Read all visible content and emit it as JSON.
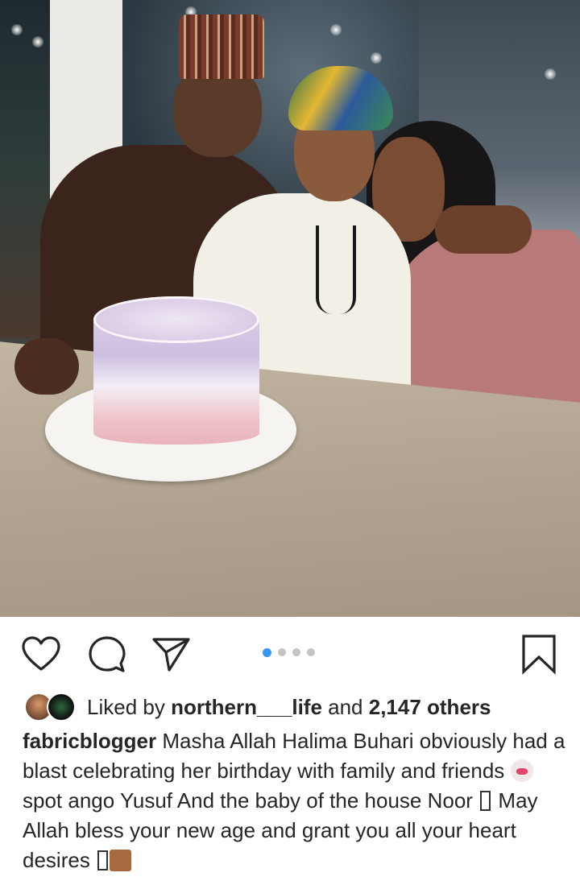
{
  "post": {
    "photo_alt": "",
    "carousel": {
      "count": 4,
      "active_index": 0
    }
  },
  "actions": {
    "like_icon": "heart-outline-icon",
    "comment_icon": "comment-bubble-icon",
    "share_icon": "paper-plane-icon",
    "save_icon": "bookmark-outline-icon"
  },
  "likes": {
    "prefix": "Liked by ",
    "user": "northern___life",
    "middle": " and ",
    "count": "2,147 others"
  },
  "caption": {
    "username": "fabricblogger",
    "text_1": " Masha Allah Halima Buhari obviously had a blast celebrating her birthday with family and friends ",
    "text_2": "spot ango Yusuf And the baby of the house Noor ",
    "text_3": " May Allah bless your new age and grant you all your heart desires "
  },
  "colors": {
    "accent": "#3897f0",
    "dot_inactive": "#c4c4c4",
    "text": "#262626"
  }
}
